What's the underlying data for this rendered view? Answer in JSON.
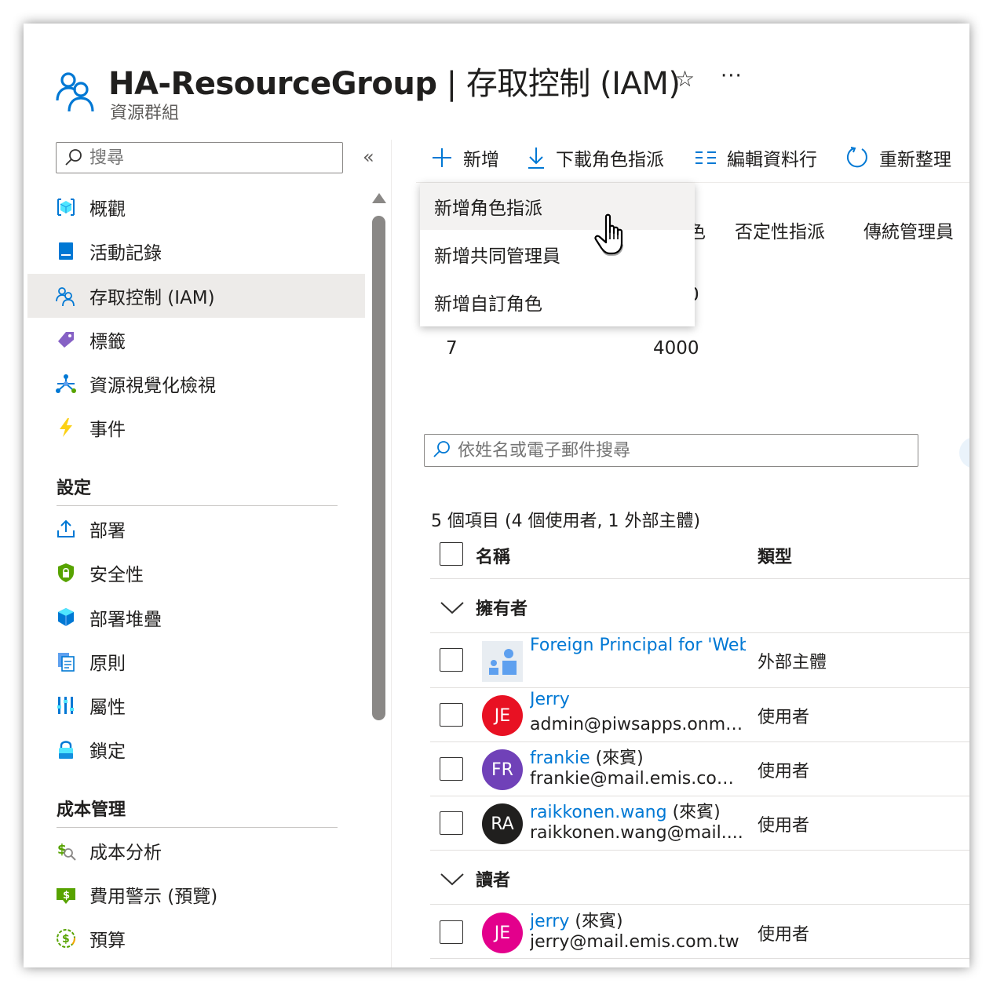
{
  "header": {
    "title_main": "HA-ResourceGroup",
    "title_rest": " | 存取控制 (IAM)",
    "subtitle": "資源群組",
    "favorite_symbol": "☆",
    "more_symbol": "···"
  },
  "sidebar": {
    "search_placeholder": "搜尋",
    "collapse_symbol": "«",
    "items": [
      {
        "label": "概觀",
        "icon": "overview-icon"
      },
      {
        "label": "活動記錄",
        "icon": "activity-log-icon"
      },
      {
        "label": "存取控制 (IAM)",
        "icon": "iam-icon",
        "selected": true
      },
      {
        "label": "標籤",
        "icon": "tag-icon"
      },
      {
        "label": "資源視覺化檢視",
        "icon": "resource-visualizer-icon"
      },
      {
        "label": "事件",
        "icon": "events-icon"
      }
    ],
    "section_settings": "設定",
    "settings_items": [
      {
        "label": "部署",
        "icon": "deployments-icon"
      },
      {
        "label": "安全性",
        "icon": "security-icon"
      },
      {
        "label": "部署堆疊",
        "icon": "deployment-stacks-icon"
      },
      {
        "label": "原則",
        "icon": "policies-icon"
      },
      {
        "label": "屬性",
        "icon": "properties-icon"
      },
      {
        "label": "鎖定",
        "icon": "locks-icon"
      }
    ],
    "section_cost": "成本管理",
    "cost_items": [
      {
        "label": "成本分析",
        "icon": "cost-analysis-icon"
      },
      {
        "label": "費用警示 (預覽)",
        "icon": "cost-alerts-icon"
      },
      {
        "label": "預算",
        "icon": "budgets-icon"
      }
    ]
  },
  "toolbar": {
    "add": "新增",
    "download": "下載角色指派",
    "edit_columns": "編輯資料行",
    "refresh": "重新整理"
  },
  "add_menu": {
    "items": [
      "新增角色指派",
      "新增共同管理員",
      "新增自訂角色"
    ]
  },
  "tabs_visible": {
    "partial": "色",
    "deny": "否定性指派",
    "classic": "傳統管理員"
  },
  "counts": {
    "partial_value": "0",
    "left_value": "7",
    "right_value": "4000"
  },
  "main": {
    "search_placeholder": "依姓名或電子郵件搜尋",
    "item_count": "5 個項目 (4 個使用者, 1 外部主體)",
    "columns": {
      "name": "名稱",
      "type": "類型"
    },
    "groups": [
      {
        "label": "擁有者",
        "rows": [
          {
            "name": "Foreign Principal for 'Web",
            "guest": "",
            "email": "",
            "type": "外部主體",
            "initials": "",
            "color": "#e8edf2"
          },
          {
            "name": "Jerry",
            "guest": "",
            "email": "admin@piwsapps.onmi...",
            "type": "使用者",
            "initials": "JE",
            "color": "#e81123"
          },
          {
            "name": "frankie",
            "guest": " (來賓)",
            "email": "frankie@mail.emis.com....",
            "type": "使用者",
            "initials": "FR",
            "color": "#7041b8"
          },
          {
            "name": "raikkonen.wang",
            "guest": " (來賓)",
            "email": "raikkonen.wang@mail....",
            "type": "使用者",
            "initials": "RA",
            "color": "#201f1e"
          }
        ]
      },
      {
        "label": "讀者",
        "rows": [
          {
            "name": "jerry",
            "guest": " (來賓)",
            "email": "jerry@mail.emis.com.tw",
            "type": "使用者",
            "initials": "JE",
            "color": "#e3008c"
          }
        ]
      }
    ]
  },
  "colors": {
    "accent": "#0078d4",
    "selected_bg": "#edebe9",
    "menu_hover": "#f3f2f1"
  }
}
